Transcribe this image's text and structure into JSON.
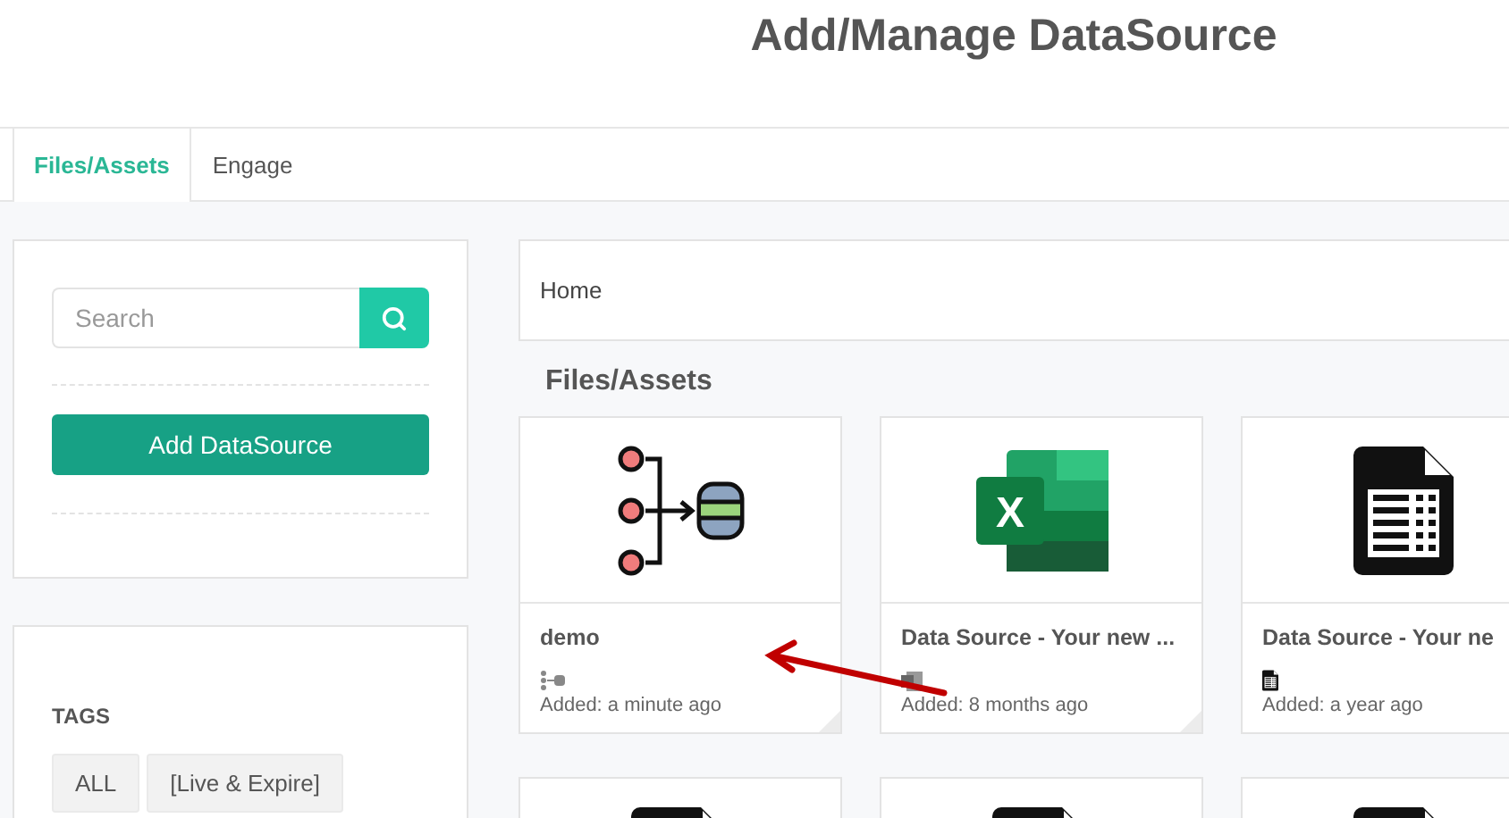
{
  "page_title": "Add/Manage DataSource",
  "tabs": [
    {
      "label": "Files/Assets",
      "selected": true
    },
    {
      "label": "Engage",
      "selected": false
    }
  ],
  "search": {
    "placeholder": "Search"
  },
  "add_button": "Add DataSource",
  "tags": {
    "heading": "TAGS",
    "items": [
      "ALL",
      "[Live & Expire]"
    ]
  },
  "breadcrumb": "Home",
  "section_heading": "Files/Assets",
  "cards": [
    {
      "kind": "flow",
      "title": "demo",
      "added": "Added: a minute ago"
    },
    {
      "kind": "excel",
      "icon_letter": "X",
      "title": "Data Source - Your new ...",
      "added": "Added: 8 months ago"
    },
    {
      "kind": "sheet",
      "title": "Data Source - Your ne",
      "added": "Added: a year ago"
    },
    {
      "kind": "sheet"
    },
    {
      "kind": "sheet"
    },
    {
      "kind": "sheet"
    }
  ]
}
